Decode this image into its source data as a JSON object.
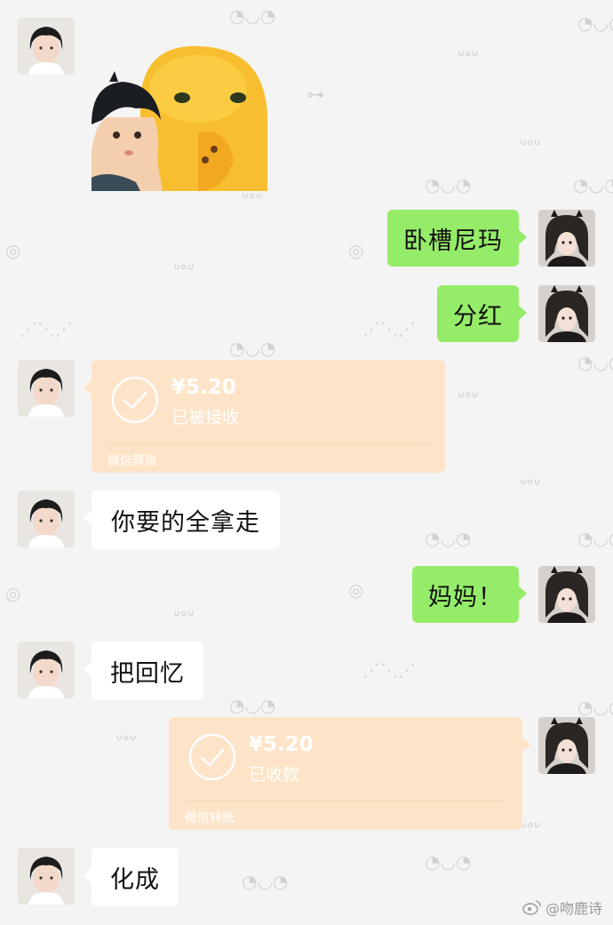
{
  "messages": [
    {
      "type": "sticker",
      "side": "left"
    },
    {
      "type": "text",
      "side": "right",
      "text": "卧槽尼玛"
    },
    {
      "type": "text",
      "side": "right",
      "text": "分红"
    },
    {
      "type": "transfer",
      "side": "left",
      "amount": "¥5.20",
      "status": "已被接收",
      "footer": "微信转账"
    },
    {
      "type": "text",
      "side": "left",
      "text": "你要的全拿走"
    },
    {
      "type": "text",
      "side": "right",
      "text": "妈妈！"
    },
    {
      "type": "text",
      "side": "left",
      "text": "把回忆"
    },
    {
      "type": "transfer",
      "side": "right",
      "amount": "¥5.20",
      "status": "已收款",
      "footer": "微信转账"
    },
    {
      "type": "text",
      "side": "left",
      "text": "化成"
    }
  ],
  "watermark": {
    "text": "@吻鹿诗",
    "icon": "weibo-icon"
  },
  "colors": {
    "background": "#f4f4f4",
    "bubble_right": "#95ec69",
    "bubble_left": "#ffffff",
    "transfer": "#fde4c8"
  }
}
